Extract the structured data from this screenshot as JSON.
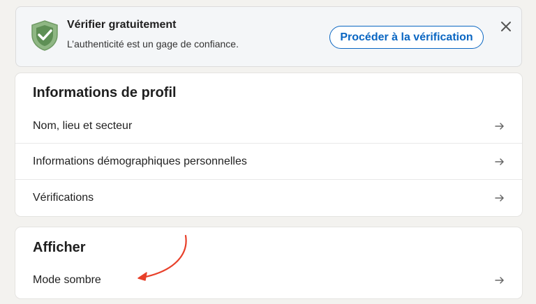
{
  "banner": {
    "title": "Vérifier gratuitement",
    "subtitle": "L’authenticité est un gage de confiance.",
    "verify_button": "Procéder à la vérification"
  },
  "profile_section": {
    "title": "Informations de profil",
    "items": [
      {
        "label": "Nom, lieu et secteur"
      },
      {
        "label": "Informations démographiques personnelles"
      },
      {
        "label": "Vérifications"
      }
    ]
  },
  "display_section": {
    "title": "Afficher",
    "items": [
      {
        "label": "Mode sombre"
      }
    ]
  },
  "colors": {
    "accent": "#0a66c2",
    "shield_fill": "#8fb784",
    "annotation_arrow": "#e8402a"
  },
  "icons": {
    "shield": "shield-check-icon",
    "close": "close-icon",
    "row_arrow": "arrow-right-icon"
  }
}
